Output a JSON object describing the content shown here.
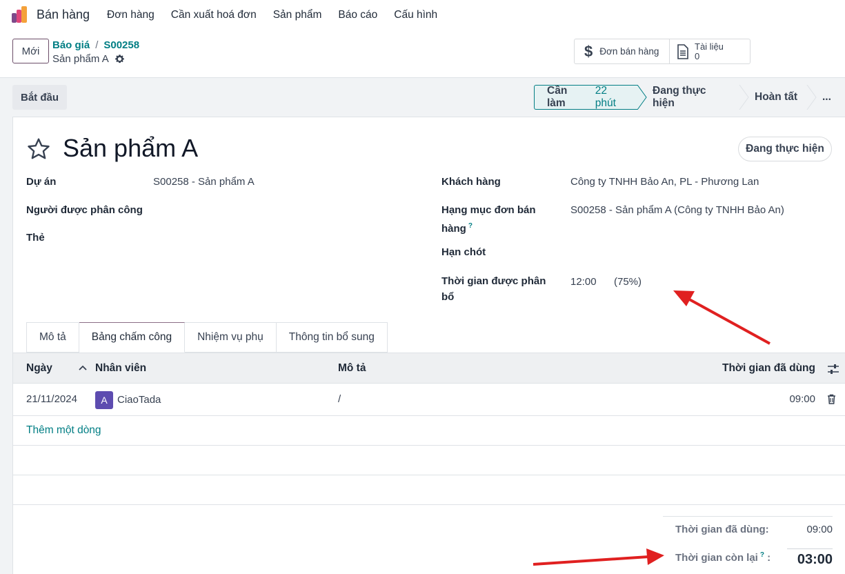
{
  "navbar": {
    "app_name": "Bán hàng",
    "menu": [
      "Đơn hàng",
      "Cần xuất hoá đơn",
      "Sản phẩm",
      "Báo cáo",
      "Cấu hình"
    ]
  },
  "control_panel": {
    "new_label": "Mới",
    "breadcrumb": [
      "Báo giá",
      "S00258"
    ],
    "current": "Sản phẩm A",
    "smart_buttons": {
      "sales_order": "Đơn bán hàng",
      "documents_label": "Tài liệu",
      "documents_count": "0"
    }
  },
  "statusbar": {
    "start_label": "Bắt đầu",
    "stages": [
      {
        "label": "Cần làm",
        "count": "22 phút",
        "active": true
      },
      {
        "label": "Đang thực hiện"
      },
      {
        "label": "Hoàn tất"
      },
      {
        "label": "..."
      }
    ]
  },
  "form": {
    "title": "Sản phẩm A",
    "state_button": "Đang thực hiện",
    "left_fields": [
      {
        "label": "Dự án",
        "value": "S00258 - Sản phẩm A"
      },
      {
        "label": "Người được phân công",
        "value": ""
      },
      {
        "label": "Thẻ",
        "value": ""
      }
    ],
    "right_fields": {
      "customer_label": "Khách hàng",
      "customer_value": "Công ty TNHH Bảo An, PL - Phương Lan",
      "sol_label_1": "Hạng mục đơn bán",
      "sol_label_2": "hàng",
      "sol_help": "?",
      "sol_value": "S00258 - Sản phẩm A (Công ty TNHH Bảo An)",
      "deadline_label": "Hạn chót",
      "alloc_label_1": "Thời gian được phân",
      "alloc_label_2": "bổ",
      "alloc_value": "12:00",
      "alloc_percent": "(75%)"
    }
  },
  "tabs": [
    "Mô tả",
    "Bảng chấm công",
    "Nhiệm vụ phụ",
    "Thông tin bổ sung"
  ],
  "timesheet": {
    "headers": {
      "date": "Ngày",
      "employee": "Nhân viên",
      "description": "Mô tả",
      "time_spent": "Thời gian đã dùng"
    },
    "rows": [
      {
        "date": "21/11/2024",
        "avatar": "A",
        "employee": "CiaoTada",
        "description": "/",
        "time": "09:00"
      }
    ],
    "add_line": "Thêm một dòng"
  },
  "totals": {
    "spent_label": "Thời gian đã dùng:",
    "spent_value": "09:00",
    "remaining_label": "Thời gian còn lại",
    "remaining_help": "?",
    "remaining_colon": ":",
    "remaining_value": "03:00"
  },
  "colors": {
    "accent": "#017e84",
    "brand": "#714b67",
    "annotation_arrow": "#e02020"
  }
}
